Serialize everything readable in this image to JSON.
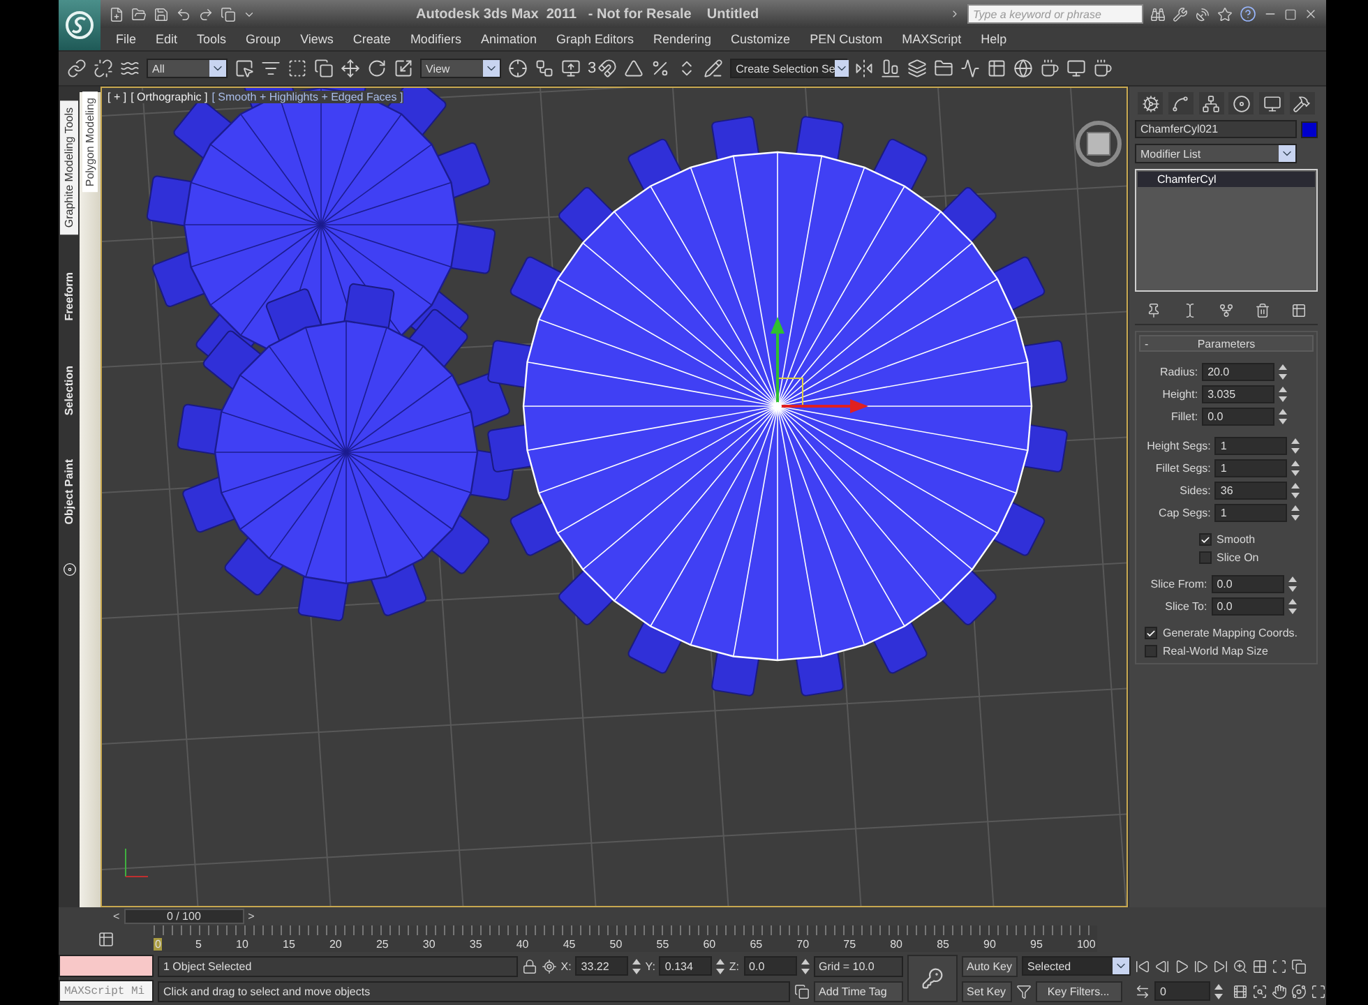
{
  "title_bar": {
    "title": "Autodesk 3ds Max  2011   - Not for Resale    Untitled",
    "search": {
      "placeholder": "Type a keyword or phrase"
    }
  },
  "menu": [
    "File",
    "Edit",
    "Tools",
    "Group",
    "Views",
    "Create",
    "Modifiers",
    "Animation",
    "Graph Editors",
    "Rendering",
    "Customize",
    "PEN Custom",
    "MAXScript",
    "Help"
  ],
  "main_toolbar": {
    "selection_filter": "All",
    "reference_coordinate_system": "View",
    "snap_label": "3",
    "named_selection_set": "Create Selection Se"
  },
  "ribbon": {
    "tabs": [
      {
        "label": "Graphite Modeling Tools",
        "selected": true
      },
      {
        "label": "Freeform",
        "selected": false
      },
      {
        "label": "Selection",
        "selected": false
      },
      {
        "label": "Object Paint",
        "selected": false
      }
    ],
    "panel": "Polygon Modeling"
  },
  "viewport": {
    "labels": [
      "[ + ]",
      "[ Orthographic ]",
      "[ Smooth + Highlights + Edged Faces ]"
    ]
  },
  "command_panel": {
    "object_name": "ChamferCyl021",
    "modifier_list": "Modifier List",
    "stack": [
      {
        "label": "ChamferCyl",
        "selected": true
      }
    ],
    "rollout": {
      "toggle": "-",
      "title": "Parameters",
      "groups": [
        {
          "kind": "spinners",
          "items": [
            {
              "label": "Radius:",
              "value": "20.0"
            },
            {
              "label": "Height:",
              "value": "3.035"
            },
            {
              "label": "Fillet:",
              "value": "0.0"
            }
          ]
        },
        {
          "kind": "spinners",
          "items": [
            {
              "label": "Height Segs:",
              "value": "1"
            },
            {
              "label": "Fillet Segs:",
              "value": "1"
            },
            {
              "label": "Sides:",
              "value": "36"
            },
            {
              "label": "Cap Segs:",
              "value": "1"
            }
          ]
        },
        {
          "kind": "centered_checks",
          "items": [
            {
              "label": "Smooth",
              "checked": true
            },
            {
              "label": "Slice On",
              "checked": false
            }
          ]
        },
        {
          "kind": "spinners",
          "items": [
            {
              "label": "Slice From:",
              "value": "0.0"
            },
            {
              "label": "Slice To:",
              "value": "0.0"
            }
          ]
        },
        {
          "kind": "checks",
          "items": [
            {
              "label": "Generate Mapping Coords.",
              "checked": true
            },
            {
              "label": "Real-World Map Size",
              "checked": false
            }
          ]
        }
      ]
    }
  },
  "timeline": {
    "prev": "<",
    "position": "0 / 100",
    "next": ">",
    "frame_labels": [
      "0",
      "5",
      "10",
      "15",
      "20",
      "25",
      "30",
      "35",
      "40",
      "45",
      "50",
      "55",
      "60",
      "65",
      "70",
      "75",
      "80",
      "85",
      "90",
      "95",
      "100"
    ]
  },
  "status_bar": {
    "listener": "MAXScript Mi",
    "selection": "1 Object Selected",
    "prompt": "Click and drag to select and move objects",
    "coordinates": [
      {
        "axis": "X:",
        "value": "33.22"
      },
      {
        "axis": "Y:",
        "value": "0.134"
      },
      {
        "axis": "Z:",
        "value": "0.0"
      }
    ],
    "grid": "Grid = 10.0",
    "add_time_tag": "Add Time Tag",
    "auto_key": {
      "label": "Auto Key",
      "on": false
    },
    "key_mode": "Selected",
    "set_key": "Set Key",
    "key_filters": "Key Filters...",
    "current_frame": "0"
  }
}
